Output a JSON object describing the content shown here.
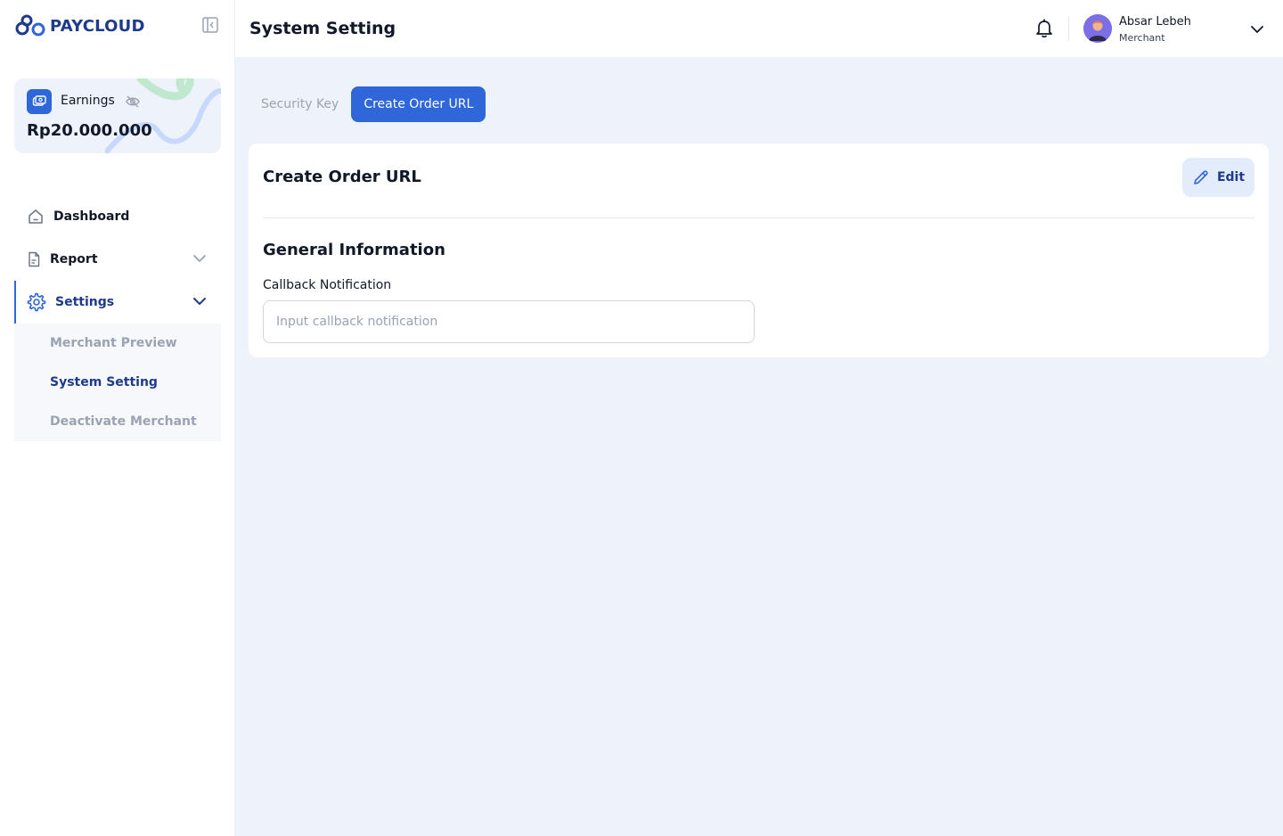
{
  "brand": {
    "name": "PAYCLOUD"
  },
  "earnings": {
    "label": "Earnings",
    "amount": "Rp20.000.000"
  },
  "nav": {
    "dashboard": "Dashboard",
    "report": "Report",
    "settings": "Settings",
    "settings_sub": {
      "merchant_preview": "Merchant Preview",
      "system_setting": "System Setting",
      "deactivate_merchant": "Deactivate Merchant"
    }
  },
  "header": {
    "title": "System Setting",
    "user": {
      "name": "Absar Lebeh",
      "role": "Merchant"
    }
  },
  "tabs": {
    "security_key": "Security Key",
    "create_order_url": "Create Order URL"
  },
  "card": {
    "title": "Create Order URL",
    "edit_label": "Edit",
    "section_title": "General Information",
    "callback": {
      "label": "Callback Notification",
      "value": "",
      "placeholder": "Input callback notification"
    }
  },
  "colors": {
    "primary": "#2f66d9",
    "brand_dark": "#1e3a8a",
    "background": "#eef2fb",
    "muted": "#9aa3b2"
  }
}
